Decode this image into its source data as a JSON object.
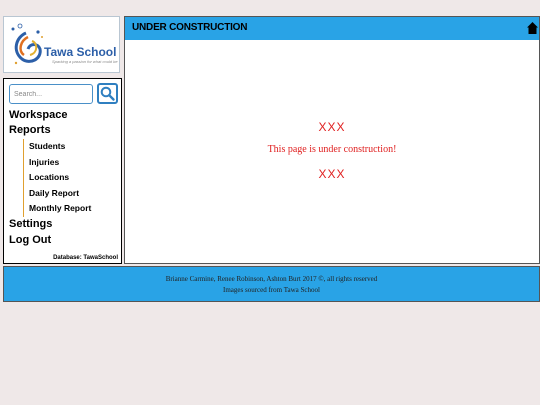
{
  "logo": {
    "name": "Tawa School",
    "tagline": "Sparking a passion for what could be"
  },
  "search": {
    "placeholder": "Search..."
  },
  "nav": {
    "workspace": "Workspace",
    "reports": "Reports",
    "report_items": [
      {
        "label": "Students"
      },
      {
        "label": "Injuries"
      },
      {
        "label": "Locations"
      },
      {
        "label": "Daily Report"
      },
      {
        "label": "Monthly Report"
      }
    ],
    "settings": "Settings",
    "logout": "Log Out",
    "database": "Database: TawaSchool"
  },
  "page": {
    "title": "UNDER CONSTRUCTION",
    "marker_top": "XXX",
    "message": "This page is under construction!",
    "marker_bottom": "XXX"
  },
  "footer": {
    "line1": "Brianne Carmine, Renee Robinson, Ashton Burt 2017 ©, all rights reserved",
    "line2": "Images sourced from Tawa School"
  },
  "colors": {
    "accent": "#29a3e6",
    "alert": "#e02020",
    "background": "#efe8e8"
  }
}
